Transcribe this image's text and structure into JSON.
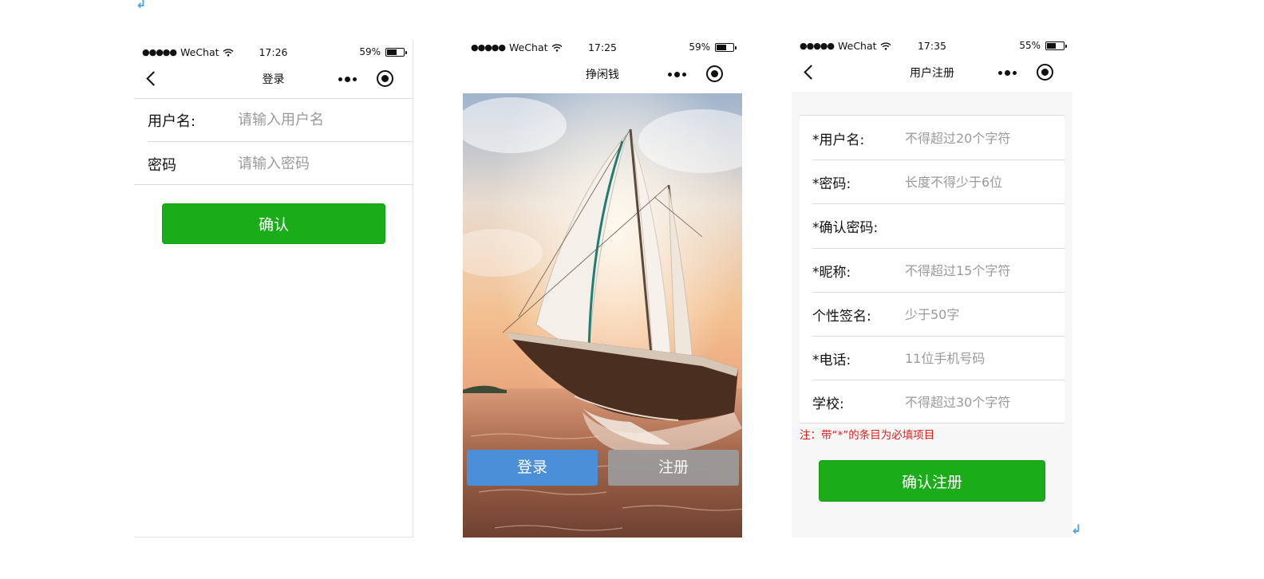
{
  "login_screen": {
    "status": {
      "carrier": "WeChat",
      "time": "17:26",
      "battery": "59%",
      "battery_level": 0.59
    },
    "nav": {
      "title": "登录"
    },
    "fields": [
      {
        "label": "用户名:",
        "placeholder": "请输入用户名",
        "value": ""
      },
      {
        "label": "密码",
        "placeholder": "请输入密码",
        "value": ""
      }
    ],
    "confirm_label": "确认"
  },
  "home_screen": {
    "status": {
      "carrier": "WeChat",
      "time": "17:25",
      "battery": "59%",
      "battery_level": 0.59
    },
    "nav": {
      "title": "挣闲钱"
    },
    "login_label": "登录",
    "register_label": "注册"
  },
  "register_screen": {
    "status": {
      "carrier": "WeChat",
      "time": "17:35",
      "battery": "55%",
      "battery_level": 0.55
    },
    "nav": {
      "title": "用户注册"
    },
    "fields": [
      {
        "label": "*用户名:",
        "placeholder": "不得超过20个字符",
        "value": ""
      },
      {
        "label": "*密码:",
        "placeholder": "长度不得少于6位",
        "value": ""
      },
      {
        "label": "*确认密码:",
        "placeholder": "",
        "value": ""
      },
      {
        "label": "*昵称:",
        "placeholder": "不得超过15个字符",
        "value": ""
      },
      {
        "label": "个性签名:",
        "placeholder": "少于50字",
        "value": ""
      },
      {
        "label": "*电话:",
        "placeholder": "11位手机号码",
        "value": ""
      },
      {
        "label": "学校:",
        "placeholder": "不得超过30个字符",
        "value": ""
      }
    ],
    "note": "注：带“*”的条目为必填项目",
    "submit_label": "确认注册"
  },
  "colors": {
    "primary_green": "#1aad19",
    "login_blue": "#4a8fd8",
    "register_gray": "#9a9a9a",
    "note_red": "#e0201e"
  },
  "icons": [
    "back-icon",
    "more-icon",
    "close-capsule-icon",
    "wifi-icon",
    "battery-icon",
    "return-mark-icon"
  ]
}
